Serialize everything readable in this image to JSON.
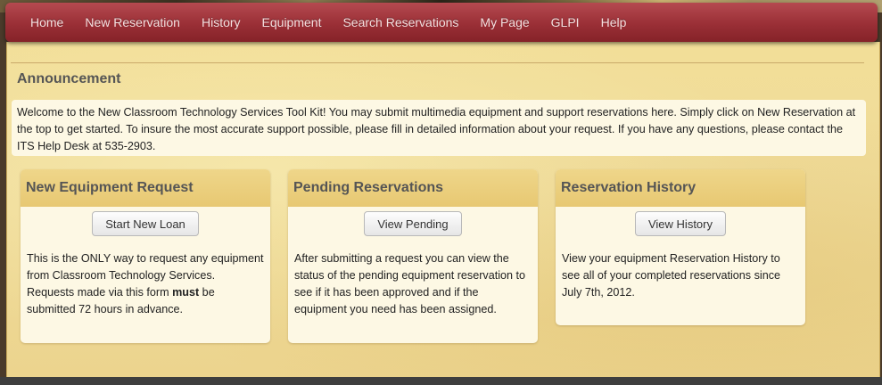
{
  "nav": {
    "items": [
      "Home",
      "New Reservation",
      "History",
      "Equipment",
      "Search Reservations",
      "My Page",
      "GLPI",
      "Help"
    ]
  },
  "announcement": {
    "title": "Announcement",
    "text": "Welcome to the New Classroom Technology Services Tool Kit! You may submit multimedia equipment and support reservations here. Simply click on New Reservation at the top to get started. To insure the most accurate support possible, please fill in detailed information about your request. If you have any questions, please contact the ITS Help Desk at 535-2903."
  },
  "panels": [
    {
      "title": "New Equipment Request",
      "button": "Start New Loan",
      "text_before": "This is the ONLY way to request any equipment from Classroom Technology Services. Requests made via this form ",
      "text_bold": "must",
      "text_after": " be submitted 72 hours in advance."
    },
    {
      "title": "Pending Reservations",
      "button": "View Pending",
      "text": "After submitting a request you can view the status of the pending equipment reservation to see if it has been approved and if the equipment you need has been assigned."
    },
    {
      "title": "Reservation History",
      "button": "View History",
      "text": "View your equipment Reservation History to see all of your completed reservations since July 7th, 2012."
    }
  ]
}
